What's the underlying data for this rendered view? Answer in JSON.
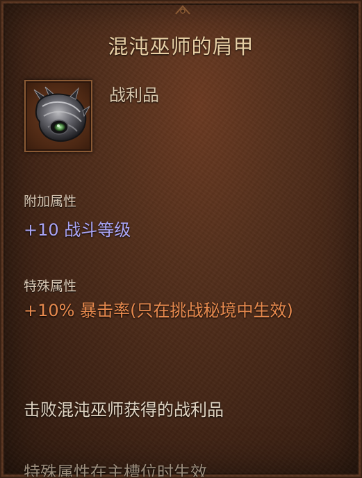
{
  "tooltip": {
    "title": "混沌巫师的肩甲",
    "item_type": "战利品",
    "item_icon": "pauldron-icon",
    "sections": {
      "bonus_label": "附加属性",
      "bonus_value": "+10 战斗等级",
      "special_label": "特殊属性",
      "special_value": "+10% 暴击率(只在挑战秘境中生效)"
    },
    "source": "击败混沌巫师获得的战利品",
    "footer": "特殊属性在主槽位时生效"
  },
  "colors": {
    "title": "#e7cfa5",
    "bonus_value": "#a9a4f5",
    "special_value": "#e88a4e",
    "background": "#54301c"
  }
}
